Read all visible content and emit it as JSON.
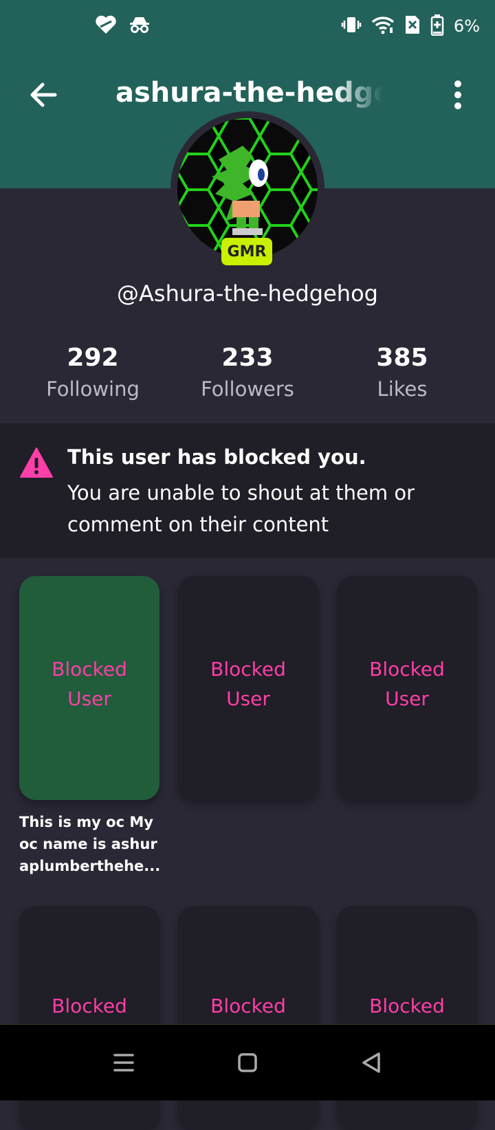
{
  "status_bar": {
    "left_icons": [
      "heart-icon",
      "incognito-icon"
    ],
    "right_icons": [
      "vibrate-icon",
      "wifi-icon",
      "sim-off-icon",
      "battery-icon"
    ],
    "battery_text": "6%"
  },
  "header": {
    "title": "ashura-the-hedgeh",
    "back_icon": "arrow-back-icon",
    "menu_icon": "more-vertical-icon"
  },
  "profile": {
    "badge": "GMR",
    "handle": "@Ashura-the-hedgehog"
  },
  "stats": [
    {
      "value": "292",
      "label": "Following"
    },
    {
      "value": "233",
      "label": "Followers"
    },
    {
      "value": "385",
      "label": "Likes"
    }
  ],
  "blocked_banner": {
    "title": "This user has blocked you.",
    "body": "You are unable to shout at them or comment on their content"
  },
  "posts": [
    {
      "line1": "Blocked",
      "line2": "User",
      "color": "#215c3b",
      "caption": "This is my oc My oc name is ashur aplumberthehe..."
    },
    {
      "line1": "Blocked",
      "line2": "User",
      "color": "#201e27"
    },
    {
      "line1": "Blocked",
      "line2": "User",
      "color": "#201e27"
    },
    {
      "line1": "Blocked",
      "line2": "",
      "color": "#201e27"
    },
    {
      "line1": "Blocked",
      "line2": "",
      "color": "#201e27"
    },
    {
      "line1": "Blocked",
      "line2": "",
      "color": "#201e27"
    }
  ],
  "colors": {
    "header_bg": "#22625a",
    "page_bg": "#2b2835",
    "accent_pink": "#ff3fa8",
    "badge": "#c8f000"
  },
  "nav_bar": {
    "buttons": [
      "recents-icon",
      "home-icon",
      "back-triangle-icon"
    ]
  }
}
